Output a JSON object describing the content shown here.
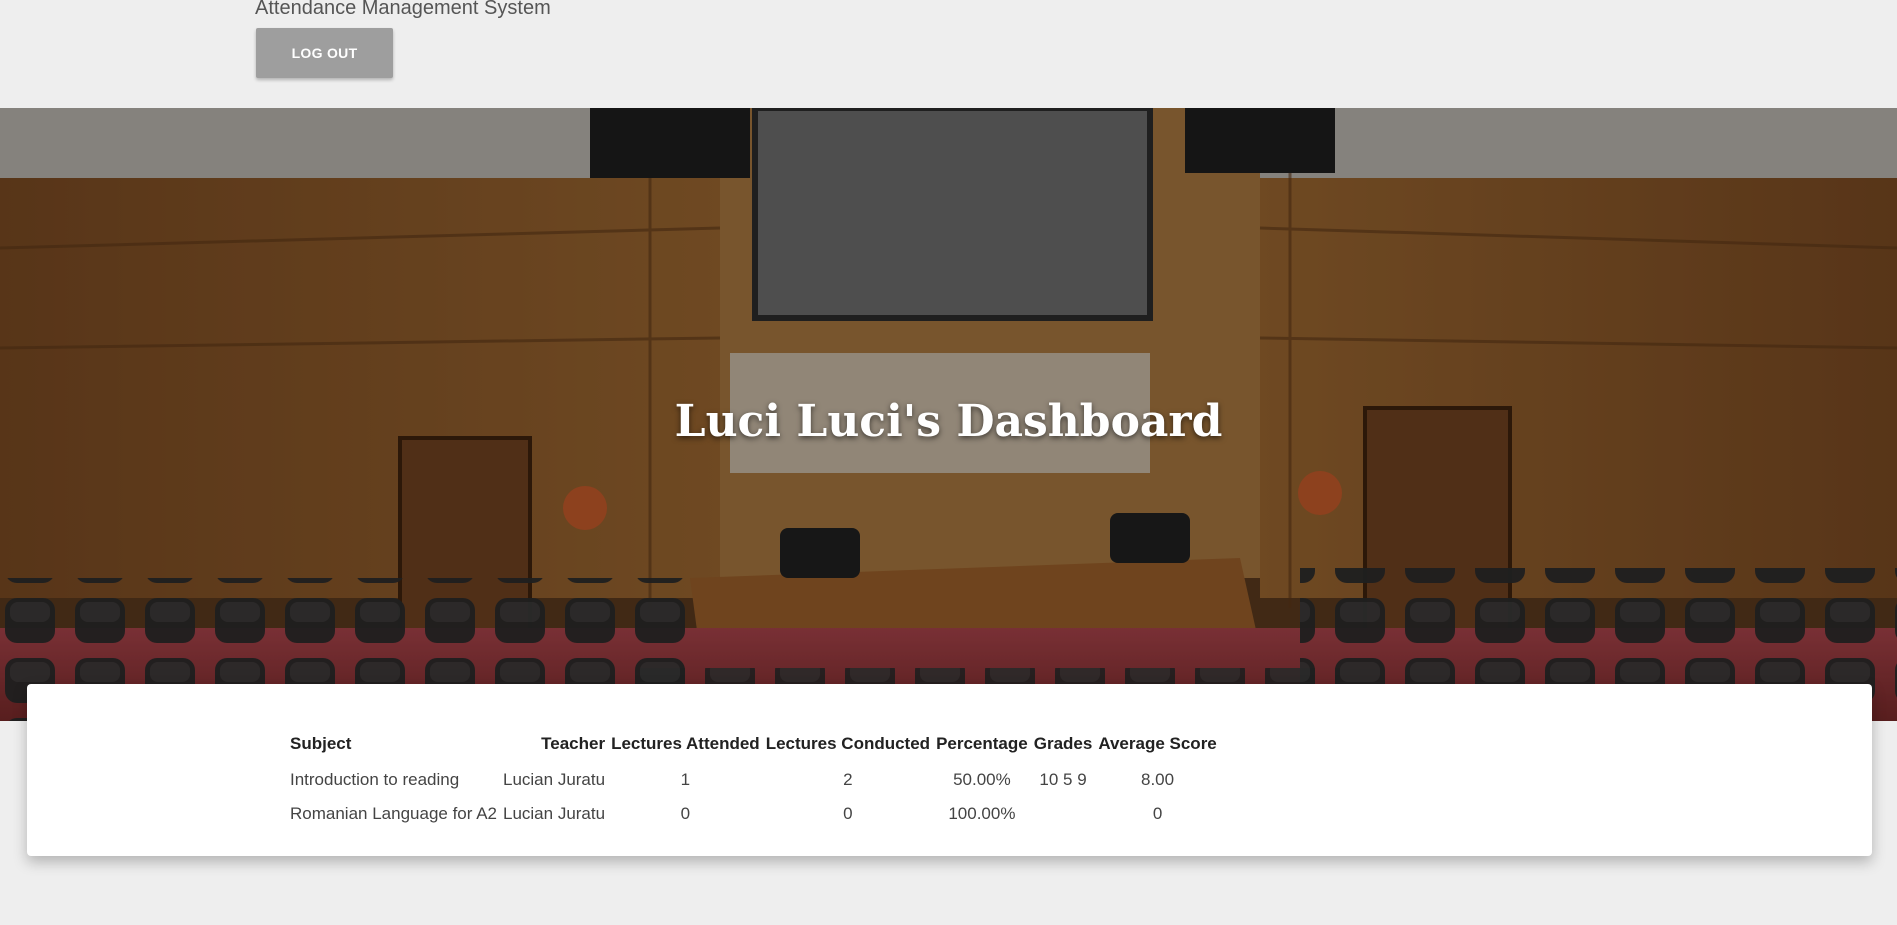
{
  "header": {
    "app_title": "Attendance Management System",
    "logout_label": "LOG OUT"
  },
  "hero": {
    "title": "Luci Luci's Dashboard"
  },
  "table": {
    "columns": [
      "Subject",
      "Teacher",
      "Lectures Attended",
      "Lectures Conducted",
      "Percentage",
      "Grades",
      "Average Score"
    ],
    "rows": [
      [
        "Introduction to reading",
        "Lucian Juratu",
        "1",
        "2",
        "50.00%",
        "10 5 9",
        "8.00"
      ],
      [
        "Romanian Language for A2",
        "Lucian Juratu",
        "0",
        "0",
        "100.00%",
        "",
        "0"
      ]
    ]
  },
  "colors": {
    "page_bg": "#eeeeee",
    "button_bg": "#9e9e9e",
    "wood": "#8b5a2b",
    "carpet": "#b23a3a"
  }
}
